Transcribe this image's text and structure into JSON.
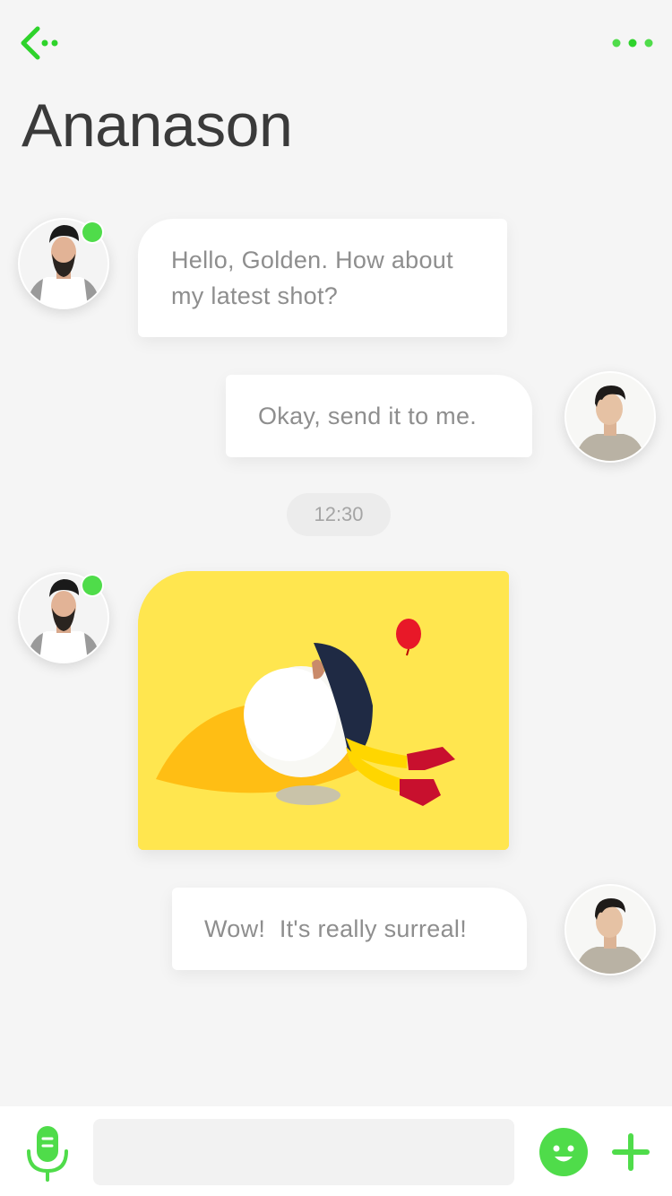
{
  "header": {
    "title": "Ananason",
    "back_icon": "back-arrow-icon",
    "more_icon": "more-dots-icon",
    "accent_color": "#2ed32b"
  },
  "messages": [
    {
      "from": "contact",
      "text_lines": [
        "Hello, Golden. How about",
        "my latest shot?"
      ],
      "online": true
    },
    {
      "from": "me",
      "text": "Okay, send it to me."
    },
    {
      "timestamp": "12:30"
    },
    {
      "from": "contact",
      "type": "photo",
      "online": true
    },
    {
      "from": "me",
      "text": "Wow!  It's really surreal!"
    }
  ],
  "composer": {
    "input_value": "",
    "input_placeholder": "",
    "mic_icon": "microphone-icon",
    "emoji_icon": "emoji-smile-icon",
    "add_icon": "plus-icon"
  },
  "colors": {
    "online_dot": "#4fdc4a",
    "photo_background": "#ffe64f",
    "bubble_text": "#8e8e8e"
  }
}
